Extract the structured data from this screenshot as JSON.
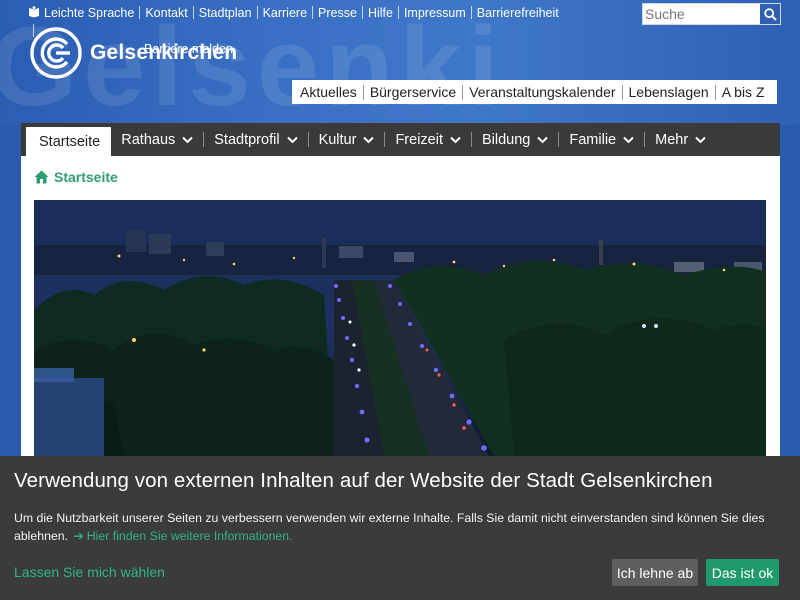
{
  "header": {
    "top_links": [
      "Leichte Sprache",
      "Kontakt",
      "Stadtplan",
      "Karriere",
      "Presse",
      "Hilfe",
      "Impressum",
      "Barrierefreiheit"
    ],
    "top_links_row2": "Barriere melden",
    "search_placeholder": "Suche",
    "logo_text": "Gelsenkirchen",
    "quick_nav": [
      "Aktuelles",
      "Bürgerservice",
      "Veranstaltungskalender",
      "Lebenslagen",
      "A bis Z"
    ]
  },
  "main_nav": {
    "active": "Startseite",
    "items": [
      "Rathaus",
      "Stadtprofil",
      "Kultur",
      "Freizeit",
      "Bildung",
      "Familie",
      "Mehr"
    ]
  },
  "breadcrumb": {
    "label": "Startseite"
  },
  "cookie_banner": {
    "title": "Verwendung von externen Inhalten auf der Website der Stadt Gelsenkirchen",
    "text": "Um die Nutzbarkeit unserer Seiten zu verbessern verwenden wir externe Inhalte. Falls Sie damit nicht einverstanden sind können Sie dies ablehnen.",
    "more_link": "Hier finden Sie weitere Informationen.",
    "choose_link": "Lassen Sie mich wählen",
    "decline_label": "Ich lehne ab",
    "accept_label": "Das ist ok"
  },
  "colors": {
    "header_blue": "#3a70c4",
    "nav_dark": "#3a3a3a",
    "accent_green": "#2e9e6e",
    "cookie_bg": "#3b3b3b",
    "accept_green": "#1f9a6a"
  },
  "icons": [
    "book-icon",
    "search-icon",
    "logo-icon",
    "chevron-down-icon",
    "home-icon",
    "arrow-right-icon"
  ]
}
